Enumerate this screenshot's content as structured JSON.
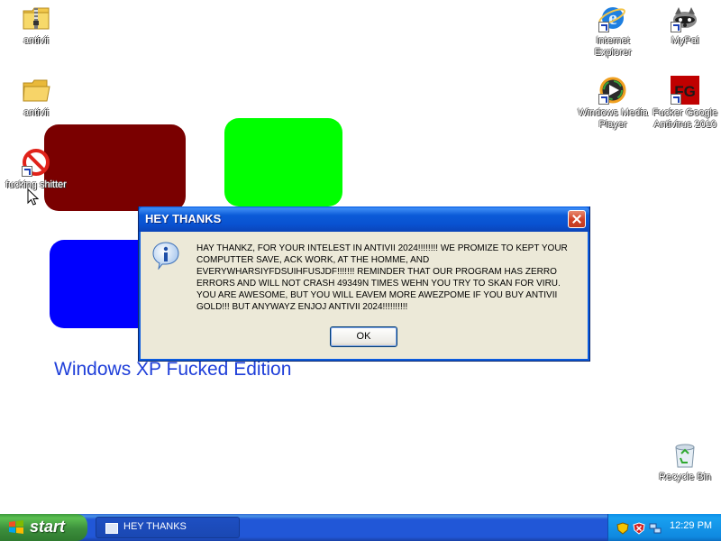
{
  "desktop": {
    "icons": [
      {
        "label": "antivii"
      },
      {
        "label": "antivii"
      },
      {
        "label": "fucking shitter"
      },
      {
        "label": "Internet Explorer"
      },
      {
        "label": "MyPal"
      },
      {
        "label": "Windows Media Player"
      },
      {
        "label": "Fucker Google Antivirus 2010"
      },
      {
        "label": "Recycle Bin"
      }
    ],
    "wallpaper_text": "Windows XP Fucked Edition",
    "shape_colors": {
      "dark_red": "#7a0000",
      "green": "#00ff00",
      "blue": "#0000ff"
    }
  },
  "dialog": {
    "title": "HEY THANKS",
    "message": "HAY THANKZ, FOR YOUR INTELEST IN ANTIVII 2024!!!!!!!! WE PROMIZE TO KEPT YOUR COMPUTTER SAVE, ACK WORK, AT THE HOMME, AND EVERYWHARSIYFDSUIHFUSJDF!!!!!!! REMINDER THAT OUR PROGRAM HAS ZERRO ERRORS AND WILL NOT CRASH 49349N TIMES WEHN YOU TRY TO SKAN FOR VIRU. YOU ARE AWESOME, BUT YOU WILL EAVEM MORE AWEZPOME IF YOU BUY ANTIVII GOLD!!! BUT ANYWAYZ ENJOJ ANTIVII 2024!!!!!!!!!!",
    "ok_label": "OK",
    "icon": "info-icon"
  },
  "taskbar": {
    "start_label": "start",
    "task_button_label": "HEY THANKS",
    "clock": "12:29 PM"
  }
}
